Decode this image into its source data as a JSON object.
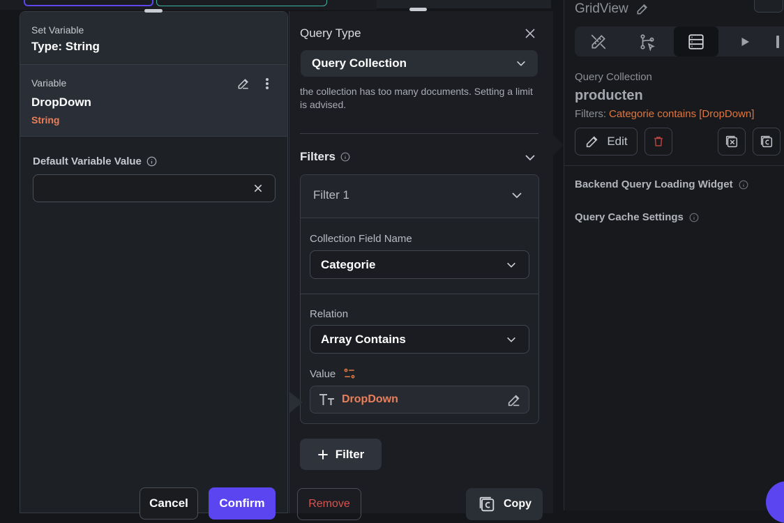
{
  "set_variable": {
    "header_label": "Set Variable",
    "header_type": "Type: String",
    "variable_label": "Variable",
    "variable_name": "DropDown",
    "variable_type": "String",
    "default_value_label": "Default Variable Value",
    "default_value": "",
    "cancel_label": "Cancel",
    "confirm_label": "Confirm"
  },
  "query": {
    "type_label": "Query Type",
    "type_value": "Query Collection",
    "note": "the collection has too many documents. Setting a limit is advised.",
    "filters_label": "Filters",
    "filter": {
      "title": "Filter 1",
      "field_label": "Collection Field Name",
      "field_value": "Categorie",
      "relation_label": "Relation",
      "relation_value": "Array Contains",
      "value_label": "Value",
      "value_text": "DropDown"
    },
    "add_filter_label": "Filter",
    "remove_label": "Remove",
    "copy_label": "Copy"
  },
  "properties": {
    "title": "GridView",
    "query_collection_label": "Query Collection",
    "collection_name": "producten",
    "filters_prefix": "Filters:",
    "filters_value": "Categorie contains [DropDown]",
    "edit_label": "Edit",
    "loading_widget_label": "Backend Query Loading Widget",
    "cache_settings_label": "Query Cache Settings"
  },
  "colors": {
    "accent": "#5b45f0",
    "type_orange": "#e9805b",
    "danger": "#d9534f"
  }
}
